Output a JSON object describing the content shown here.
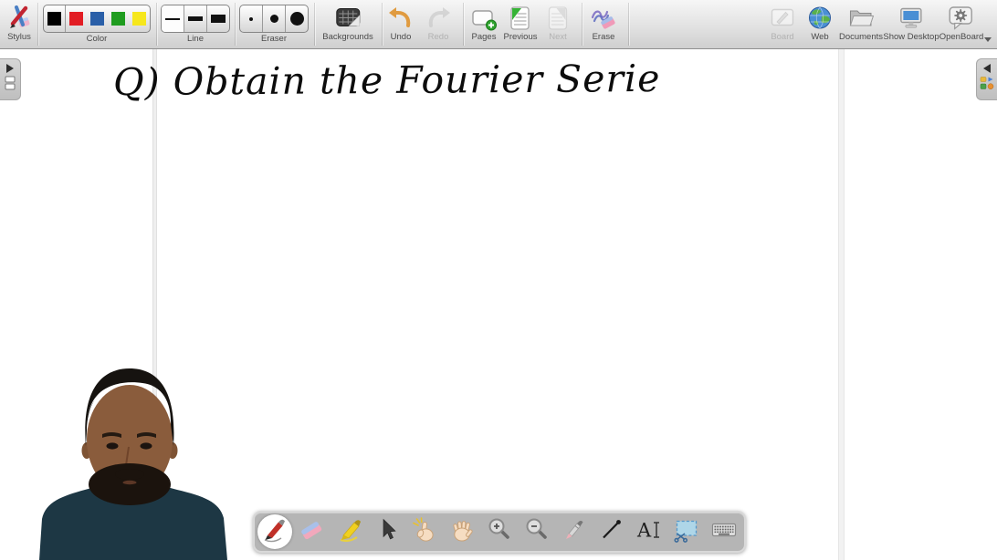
{
  "topbar": {
    "stylus": {
      "label": "Stylus",
      "icon": "stylus-pens-icon"
    },
    "color": {
      "label": "Color",
      "selected": "black",
      "swatches": [
        {
          "name": "black",
          "hex": "#000000",
          "selected": true
        },
        {
          "name": "red",
          "hex": "#e21d24",
          "selected": false
        },
        {
          "name": "blue",
          "hex": "#2a5fa8",
          "selected": false
        },
        {
          "name": "green",
          "hex": "#1f9c1f",
          "selected": false
        },
        {
          "name": "yellow",
          "hex": "#f6e71c",
          "selected": false
        }
      ]
    },
    "line": {
      "label": "Line",
      "options": [
        "thin",
        "medium",
        "thick"
      ],
      "selected": "thin"
    },
    "eraser": {
      "label": "Eraser",
      "options": [
        "small",
        "medium",
        "large"
      ],
      "selected": "small"
    },
    "backgrounds": {
      "label": "Backgrounds",
      "icon": "backgrounds-icon"
    },
    "undo": {
      "label": "Undo",
      "enabled": true,
      "icon": "undo-arrow-icon",
      "accent": "#e09b40"
    },
    "redo": {
      "label": "Redo",
      "enabled": false,
      "icon": "redo-arrow-icon"
    },
    "pages": {
      "label": "Pages",
      "icon": "add-page-icon",
      "accent": "#2fa32f"
    },
    "previous": {
      "label": "Previous",
      "enabled": true,
      "icon": "previous-page-icon"
    },
    "next": {
      "label": "Next",
      "enabled": false,
      "icon": "next-page-icon"
    },
    "erase": {
      "label": "Erase",
      "icon": "erase-page-icon"
    },
    "board": {
      "label": "Board",
      "enabled": false,
      "icon": "board-mode-icon"
    },
    "web": {
      "label": "Web",
      "icon": "web-globe-icon"
    },
    "documents": {
      "label": "Documents",
      "icon": "documents-folder-icon"
    },
    "show_desktop": {
      "label": "Show Desktop",
      "icon": "show-desktop-monitor-icon"
    },
    "openboard": {
      "label": "OpenBoard",
      "icon": "openboard-settings-icon"
    }
  },
  "canvas": {
    "handwriting": "Q) Obtain the Fourier Serie",
    "ink_color": "#000000",
    "margin_line_color": "#e8e8e8"
  },
  "side_tabs": {
    "left_icons": [
      "expand-right-arrow-icon",
      "page-navigator-icon"
    ],
    "right_icons": [
      "expand-left-arrow-icon",
      "library-icon"
    ]
  },
  "bottom_toolbar": {
    "selected_tool": "pen",
    "tools": [
      "pen",
      "eraser",
      "highlighter",
      "selector",
      "interact",
      "hand",
      "zoom-in",
      "zoom-out",
      "laser-pointer",
      "line",
      "text",
      "capture",
      "virtual-keyboard"
    ]
  },
  "webcam_overlay": {
    "visible": true
  }
}
